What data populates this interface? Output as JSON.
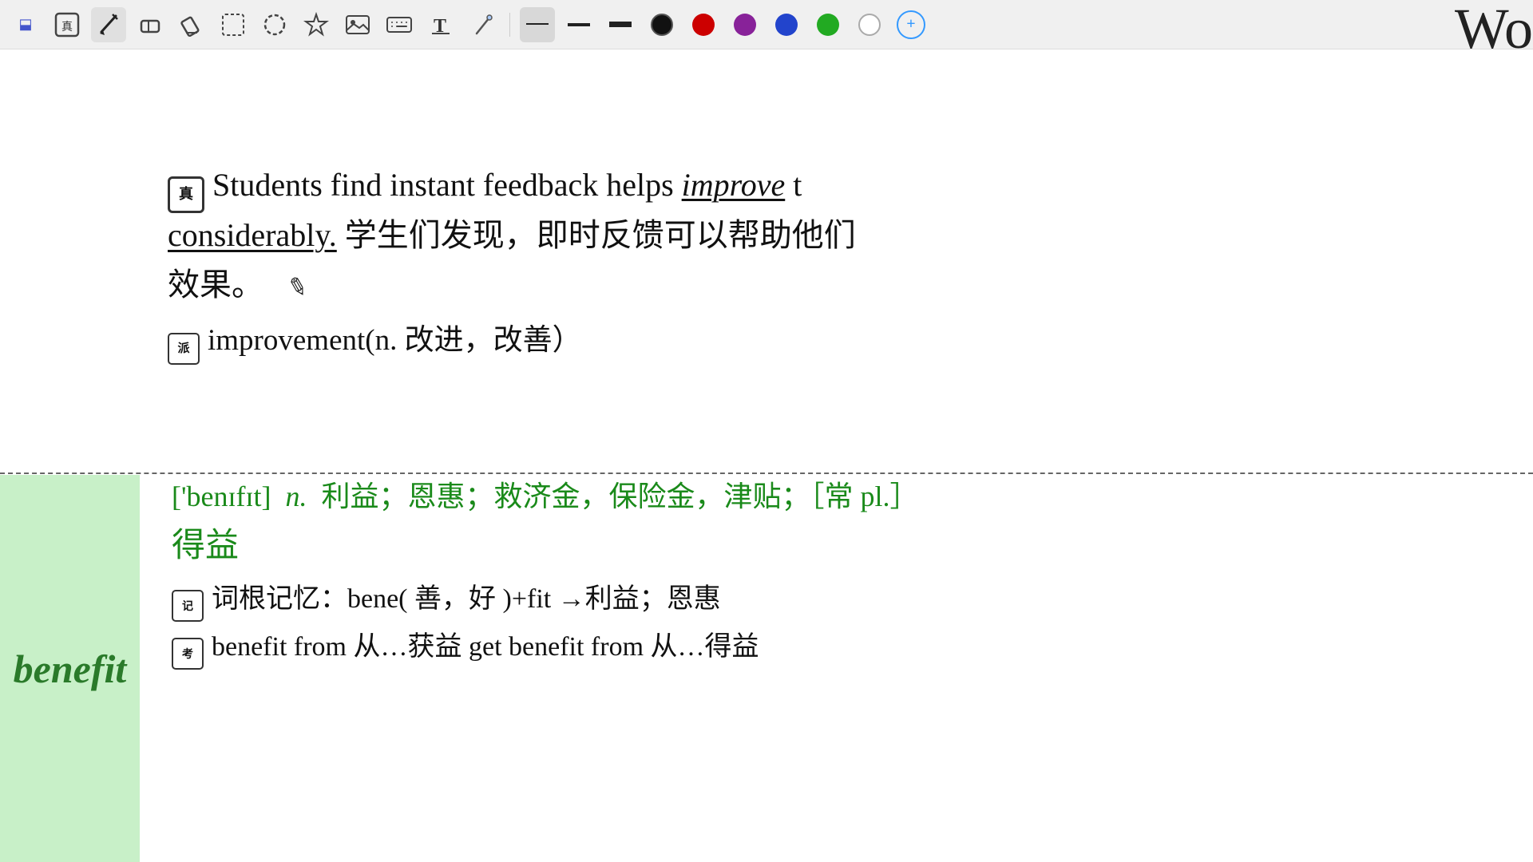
{
  "toolbar": {
    "tools": [
      {
        "name": "ocr-tool",
        "icon": "⊞",
        "label": "OCR"
      },
      {
        "name": "pen-tool",
        "icon": "✏️",
        "label": "Pen"
      },
      {
        "name": "eraser-tool",
        "icon": "⬜",
        "label": "Eraser"
      },
      {
        "name": "highlighter-tool",
        "icon": "🖊",
        "label": "Highlighter"
      },
      {
        "name": "select-tool",
        "icon": "⧉",
        "label": "Select"
      },
      {
        "name": "lasso-tool",
        "icon": "◯",
        "label": "Lasso"
      },
      {
        "name": "star-tool",
        "icon": "☆",
        "label": "Star"
      },
      {
        "name": "image-tool",
        "icon": "🖼",
        "label": "Image"
      },
      {
        "name": "keyboard-tool",
        "icon": "⌨",
        "label": "Keyboard"
      },
      {
        "name": "text-tool",
        "icon": "T",
        "label": "Text"
      },
      {
        "name": "pencil-tool",
        "icon": "✏",
        "label": "Pencil"
      }
    ],
    "stroke_selected": "thin",
    "colors": [
      "#111111",
      "#cc0000",
      "#7722cc",
      "#2244cc",
      "#22aa22"
    ],
    "white_color": "#ffffff",
    "blue_plus_badge": "+",
    "bluetooth": "bluetooth"
  },
  "corner_text": "Wo",
  "sentence": {
    "icon": "真",
    "text_before_improve": "Students find instant feedback helps",
    "improve_word": "improve",
    "text_after": "t",
    "second_line_underlined": "considerably.",
    "second_line_rest": "学生们发现，即时反馈可以帮助他们",
    "third_line": "效果。",
    "pencil_symbol": "✎",
    "derivative_icon": "派",
    "derivative_text": "improvement(n. 改进，改善）"
  },
  "benefit": {
    "word": "benefit",
    "phonetic": "['benɪfɪt]",
    "pos": "n.",
    "chinese_meanings": "利益；恩惠；救济金，保险金，津贴；［常 pl.］",
    "chinese_verb": "得益",
    "memory_icon": "记",
    "memory_text": "词根记忆：bene( 善，好 )+fit →利益；恩惠",
    "usage_icon": "考",
    "usage_text": "benefit from 从…获益 get benefit from 从…得益"
  }
}
